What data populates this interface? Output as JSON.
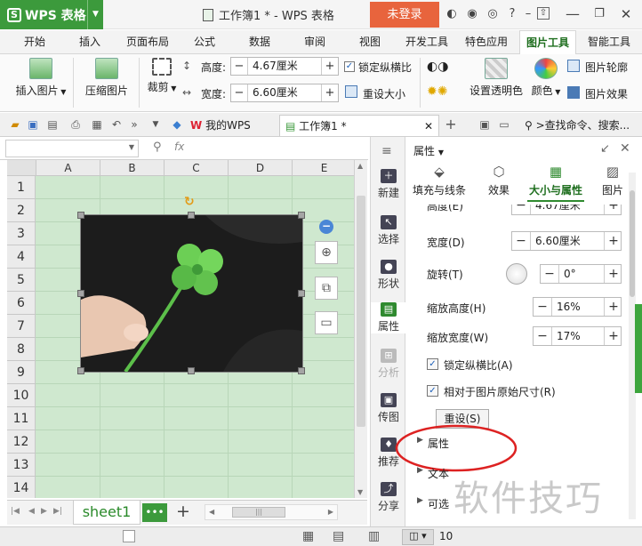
{
  "app": {
    "name": "WPS 表格",
    "window_title": "工作簿1 * - WPS 表格",
    "login": "未登录"
  },
  "ribbon_tabs": [
    "开始",
    "插入",
    "页面布局",
    "公式",
    "数据",
    "审阅",
    "视图",
    "开发工具",
    "特色应用",
    "图片工具",
    "智能工具"
  ],
  "active_tab": "图片工具",
  "ribbon": {
    "insert_picture": "插入图片",
    "compress_picture": "压缩图片",
    "crop": "裁剪",
    "height_label": "高度:",
    "height_value": "4.67厘米",
    "width_label": "宽度:",
    "width_value": "6.60厘米",
    "lock_ratio": "锁定纵横比",
    "reset_size": "重设大小",
    "set_transparent": "设置透明色",
    "color": "颜色",
    "picture_outline": "图片轮廓",
    "picture_effect": "图片效果"
  },
  "quickbar": {
    "mywps": "我的WPS",
    "doc_tab": "工作簿1 *",
    "search": ">查找命令、搜索..."
  },
  "formula": {
    "fx": "fx"
  },
  "sheet": {
    "columns": [
      "A",
      "B",
      "C",
      "D",
      "E"
    ],
    "rows": [
      "1",
      "2",
      "3",
      "4",
      "5",
      "6",
      "7",
      "8",
      "9",
      "10",
      "11",
      "12",
      "13",
      "14"
    ],
    "sheet_name": "sheet1",
    "more": "•••",
    "add": "+"
  },
  "taskstrip": [
    "新建",
    "选择",
    "形状",
    "属性",
    "分析",
    "传图",
    "推荐",
    "分享"
  ],
  "pane": {
    "title": "属性",
    "tabs": [
      "填充与线条",
      "效果",
      "大小与属性",
      "图片"
    ],
    "active_tab": "大小与属性",
    "height_label": "高度(E)",
    "height_value": "4.67厘米",
    "width_label": "宽度(D)",
    "width_value": "6.60厘米",
    "rotate_label": "旋转(T)",
    "rotate_value": "0°",
    "scale_h_label": "缩放高度(H)",
    "scale_h_value": "16%",
    "scale_w_label": "缩放宽度(W)",
    "scale_w_value": "17%",
    "lock_ratio": "锁定纵横比(A)",
    "relative_original": "相对于图片原始尺寸(R)",
    "reset": "重设(S)",
    "section_props": "属性",
    "section_text": "文本",
    "section_optional": "可选"
  },
  "status": {
    "zoom": "10"
  },
  "watermark": "软件技巧",
  "colors": {
    "accent": "#3c9a3c",
    "login": "#e8643d",
    "sheet_bg": "#cfe8cf"
  }
}
